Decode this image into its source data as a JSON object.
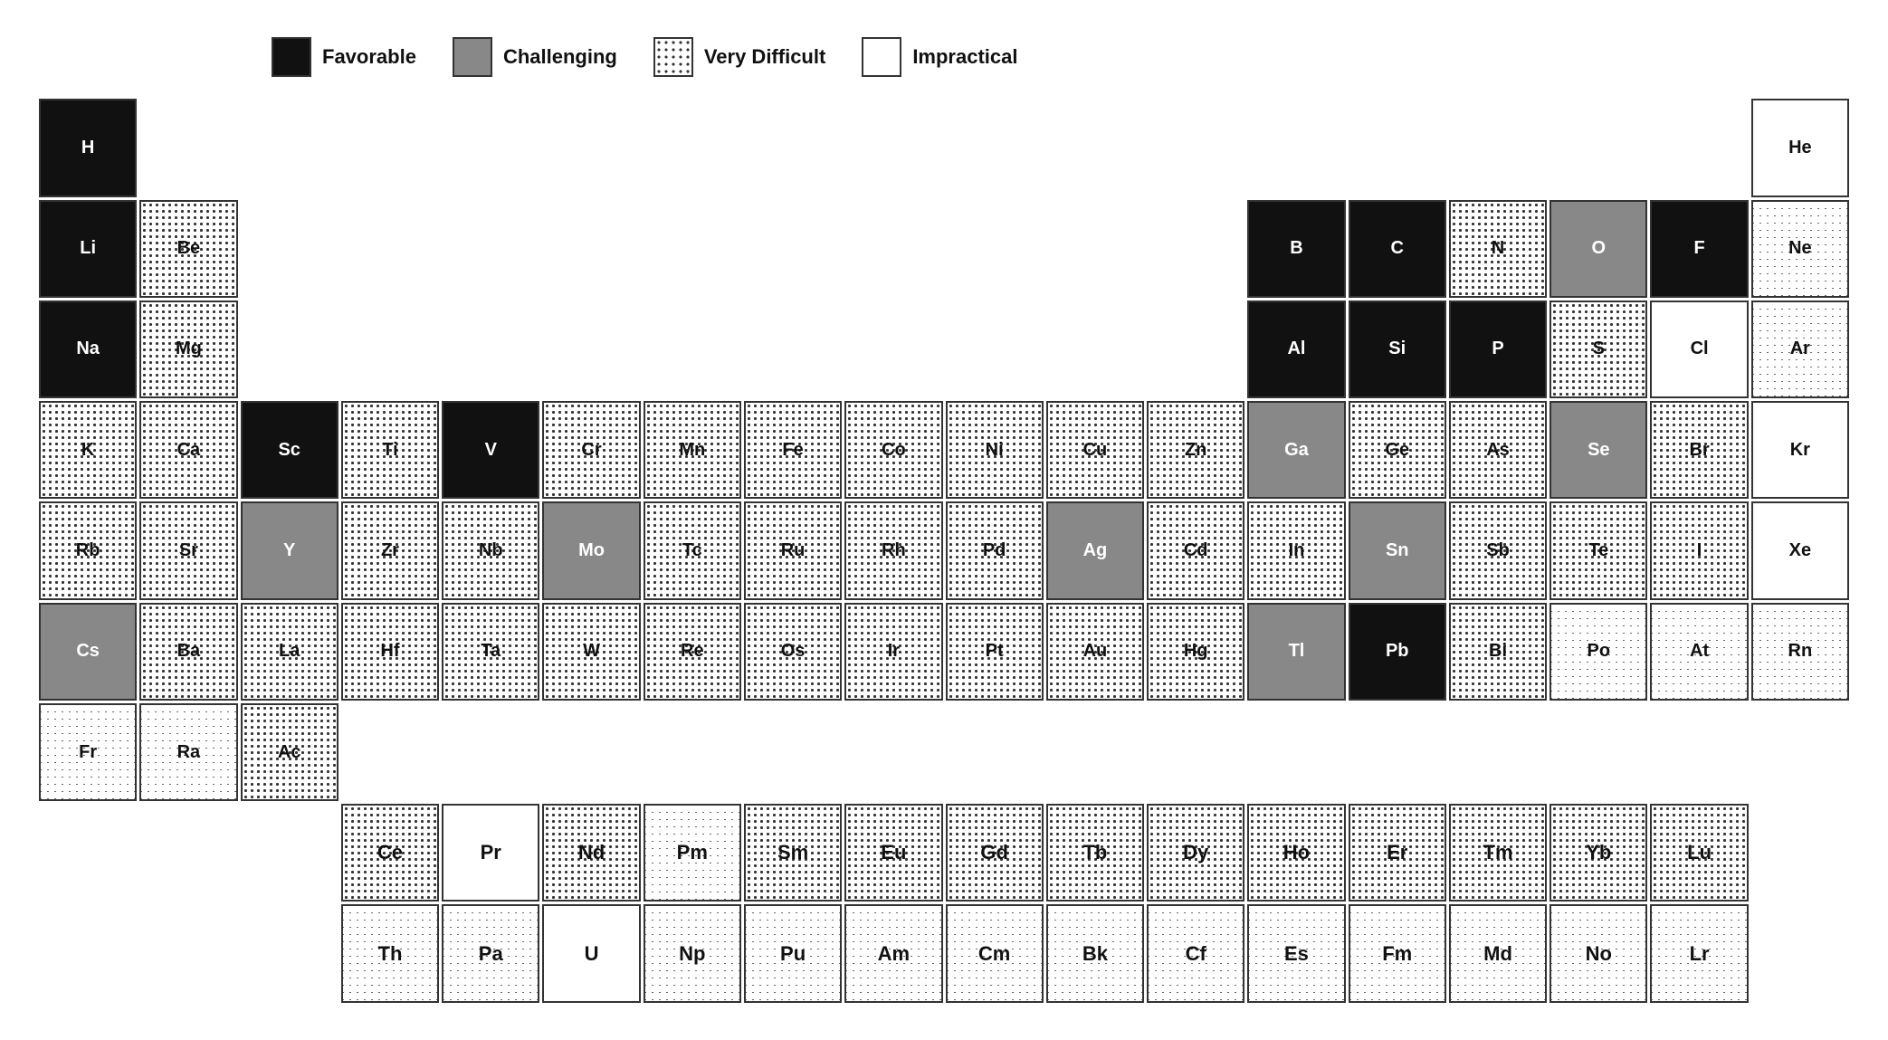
{
  "legend": {
    "items": [
      {
        "label": "Favorable",
        "class": "lb-favorable"
      },
      {
        "label": "Challenging",
        "class": "lb-challenging"
      },
      {
        "label": "Very Difficult",
        "class": "lb-verydifficult"
      },
      {
        "label": "Impractical",
        "class": "lb-impractical"
      }
    ]
  },
  "elements": {
    "row1": [
      {
        "symbol": "H",
        "type": "favorable",
        "col": 1
      },
      {
        "symbol": "He",
        "type": "impractical",
        "col": 18
      }
    ],
    "row2": [
      {
        "symbol": "Li",
        "type": "favorable",
        "col": 1
      },
      {
        "symbol": "Be",
        "type": "verydifficult",
        "col": 2
      },
      {
        "symbol": "B",
        "type": "favorable",
        "col": 13
      },
      {
        "symbol": "C",
        "type": "favorable",
        "col": 14
      },
      {
        "symbol": "N",
        "type": "verydifficult",
        "col": 15
      },
      {
        "symbol": "O",
        "type": "challenging",
        "col": 16
      },
      {
        "symbol": "F",
        "type": "favorable",
        "col": 17
      },
      {
        "symbol": "Ne",
        "type": "xdifficult",
        "col": 18
      }
    ],
    "row3": [
      {
        "symbol": "Na",
        "type": "favorable",
        "col": 1
      },
      {
        "symbol": "Mg",
        "type": "verydifficult",
        "col": 2
      },
      {
        "symbol": "Al",
        "type": "favorable",
        "col": 13
      },
      {
        "symbol": "Si",
        "type": "favorable",
        "col": 14
      },
      {
        "symbol": "P",
        "type": "favorable",
        "col": 15
      },
      {
        "symbol": "S",
        "type": "verydifficult",
        "col": 16
      },
      {
        "symbol": "Cl",
        "type": "impractical",
        "col": 17
      },
      {
        "symbol": "Ar",
        "type": "xdifficult",
        "col": 18
      }
    ],
    "row4": [
      {
        "symbol": "K",
        "type": "verydifficult",
        "col": 1
      },
      {
        "symbol": "Ca",
        "type": "verydifficult",
        "col": 2
      },
      {
        "symbol": "Sc",
        "type": "favorable",
        "col": 3
      },
      {
        "symbol": "Ti",
        "type": "verydifficult",
        "col": 4
      },
      {
        "symbol": "V",
        "type": "favorable",
        "col": 5
      },
      {
        "symbol": "Cr",
        "type": "verydifficult",
        "col": 6
      },
      {
        "symbol": "Mn",
        "type": "verydifficult",
        "col": 7
      },
      {
        "symbol": "Fe",
        "type": "verydifficult",
        "col": 8
      },
      {
        "symbol": "Co",
        "type": "verydifficult",
        "col": 9
      },
      {
        "symbol": "Ni",
        "type": "verydifficult",
        "col": 10
      },
      {
        "symbol": "Cu",
        "type": "verydifficult",
        "col": 11
      },
      {
        "symbol": "Zn",
        "type": "verydifficult",
        "col": 12
      },
      {
        "symbol": "Ga",
        "type": "challenging",
        "col": 13
      },
      {
        "symbol": "Ge",
        "type": "verydifficult",
        "col": 14
      },
      {
        "symbol": "As",
        "type": "verydifficult",
        "col": 15
      },
      {
        "symbol": "Se",
        "type": "challenging",
        "col": 16
      },
      {
        "symbol": "Br",
        "type": "verydifficult",
        "col": 17
      },
      {
        "symbol": "Kr",
        "type": "impractical",
        "col": 18
      }
    ],
    "row5": [
      {
        "symbol": "Rb",
        "type": "verydifficult",
        "col": 1
      },
      {
        "symbol": "Sr",
        "type": "verydifficult",
        "col": 2
      },
      {
        "symbol": "Y",
        "type": "challenging",
        "col": 3
      },
      {
        "symbol": "Zr",
        "type": "verydifficult",
        "col": 4
      },
      {
        "symbol": "Nb",
        "type": "verydifficult",
        "col": 5
      },
      {
        "symbol": "Mo",
        "type": "challenging",
        "col": 6
      },
      {
        "symbol": "Tc",
        "type": "verydifficult",
        "col": 7
      },
      {
        "symbol": "Ru",
        "type": "verydifficult",
        "col": 8
      },
      {
        "symbol": "Rh",
        "type": "verydifficult",
        "col": 9
      },
      {
        "symbol": "Pd",
        "type": "verydifficult",
        "col": 10
      },
      {
        "symbol": "Ag",
        "type": "challenging",
        "col": 11
      },
      {
        "symbol": "Cd",
        "type": "verydifficult",
        "col": 12
      },
      {
        "symbol": "In",
        "type": "verydifficult",
        "col": 13
      },
      {
        "symbol": "Sn",
        "type": "challenging",
        "col": 14
      },
      {
        "symbol": "Sb",
        "type": "verydifficult",
        "col": 15
      },
      {
        "symbol": "Te",
        "type": "verydifficult",
        "col": 16
      },
      {
        "symbol": "I",
        "type": "verydifficult",
        "col": 17
      },
      {
        "symbol": "Xe",
        "type": "impractical",
        "col": 18
      }
    ],
    "row6": [
      {
        "symbol": "Cs",
        "type": "challenging",
        "col": 1
      },
      {
        "symbol": "Ba",
        "type": "verydifficult",
        "col": 2
      },
      {
        "symbol": "La",
        "type": "verydifficult",
        "col": 3
      },
      {
        "symbol": "Hf",
        "type": "verydifficult",
        "col": 4
      },
      {
        "symbol": "Ta",
        "type": "verydifficult",
        "col": 5
      },
      {
        "symbol": "W",
        "type": "verydifficult",
        "col": 6
      },
      {
        "symbol": "Re",
        "type": "verydifficult",
        "col": 7
      },
      {
        "symbol": "Os",
        "type": "verydifficult",
        "col": 8
      },
      {
        "symbol": "Ir",
        "type": "verydifficult",
        "col": 9
      },
      {
        "symbol": "Pt",
        "type": "verydifficult",
        "col": 10
      },
      {
        "symbol": "Au",
        "type": "verydifficult",
        "col": 11
      },
      {
        "symbol": "Hg",
        "type": "verydifficult",
        "col": 12
      },
      {
        "symbol": "Tl",
        "type": "challenging",
        "col": 13
      },
      {
        "symbol": "Pb",
        "type": "favorable",
        "col": 14
      },
      {
        "symbol": "Bi",
        "type": "verydifficult",
        "col": 15
      },
      {
        "symbol": "Po",
        "type": "xdifficult",
        "col": 16
      },
      {
        "symbol": "At",
        "type": "xdifficult",
        "col": 17
      },
      {
        "symbol": "Rn",
        "type": "xdifficult",
        "col": 18
      }
    ],
    "row7": [
      {
        "symbol": "Fr",
        "type": "xdifficult",
        "col": 1
      },
      {
        "symbol": "Ra",
        "type": "xdifficult",
        "col": 2
      },
      {
        "symbol": "Ac",
        "type": "verydifficult",
        "col": 3
      }
    ],
    "lanthanides": [
      "Ce",
      "Pr",
      "Nd",
      "Pm",
      "Sm",
      "Eu",
      "Gd",
      "Tb",
      "Dy",
      "Ho",
      "Er",
      "Tm",
      "Yb",
      "Lu"
    ],
    "actinides": [
      "Th",
      "Pa",
      "U",
      "Np",
      "Pu",
      "Am",
      "Cm",
      "Bk",
      "Cf",
      "Es",
      "Fm",
      "Md",
      "No",
      "Lr"
    ],
    "lanthanide_types": [
      "verydifficult",
      "impractical",
      "verydifficult",
      "xdifficult",
      "verydifficult",
      "verydifficult",
      "verydifficult",
      "verydifficult",
      "verydifficult",
      "verydifficult",
      "verydifficult",
      "verydifficult",
      "verydifficult",
      "verydifficult"
    ],
    "actinide_types": [
      "xdifficult",
      "xdifficult",
      "impractical",
      "xdifficult",
      "xdifficult",
      "xdifficult",
      "xdifficult",
      "xdifficult",
      "xdifficult",
      "xdifficult",
      "xdifficult",
      "xdifficult",
      "xdifficult",
      "xdifficult"
    ]
  }
}
